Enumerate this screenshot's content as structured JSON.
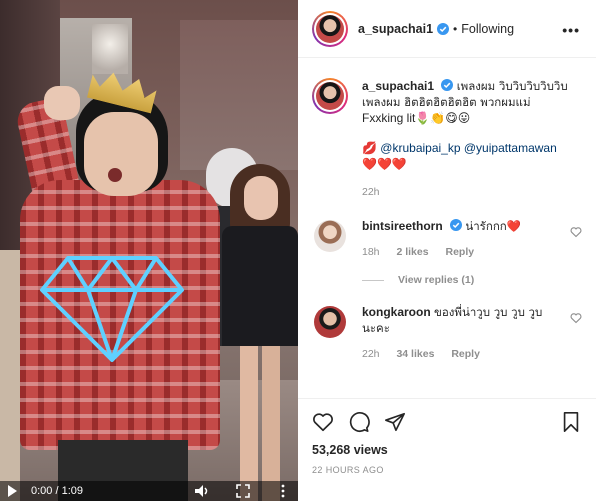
{
  "video": {
    "time": "0:00 / 1:09"
  },
  "header": {
    "username": "a_supachai1",
    "separator": "•",
    "following": "Following",
    "options": "•••"
  },
  "caption": {
    "username": "a_supachai1",
    "text_line1": "เพลงผม วิบวิบวิบวิบวิบ",
    "text_line2": "เพลงผม ฮิตฮิตฮิตฮิตฮิต พวกผมแม่",
    "text_line3": "Fxxking lit🌷👏😋😛",
    "lips": "💋",
    "mention1": "@krubaipai_kp",
    "mention2": "@yuipattamawan",
    "hearts": "❤️❤️❤️",
    "time": "22h"
  },
  "comments": [
    {
      "username": "bintsireethorn",
      "text": "น่ารักกก❤️",
      "time": "18h",
      "likes": "2 likes",
      "reply": "Reply",
      "view_replies": "View replies (1)"
    },
    {
      "username": "kongkaroon",
      "text": "ของพี่น่าวูบ วูบ วูบ วูบ",
      "text_line2": "นะคะ",
      "time": "22h",
      "likes": "34 likes",
      "reply": "Reply"
    }
  ],
  "footer": {
    "views": "53,268 views",
    "posted": "22 HOURS AGO"
  },
  "colors": {
    "verified": "#3897f0",
    "link": "#00376b",
    "muted": "#8e8e8e",
    "heart_red": "#ed4956"
  },
  "icons": {
    "like": "heart-outline-icon",
    "comment": "speech-bubble-icon",
    "share": "paper-plane-icon",
    "save": "bookmark-icon"
  }
}
